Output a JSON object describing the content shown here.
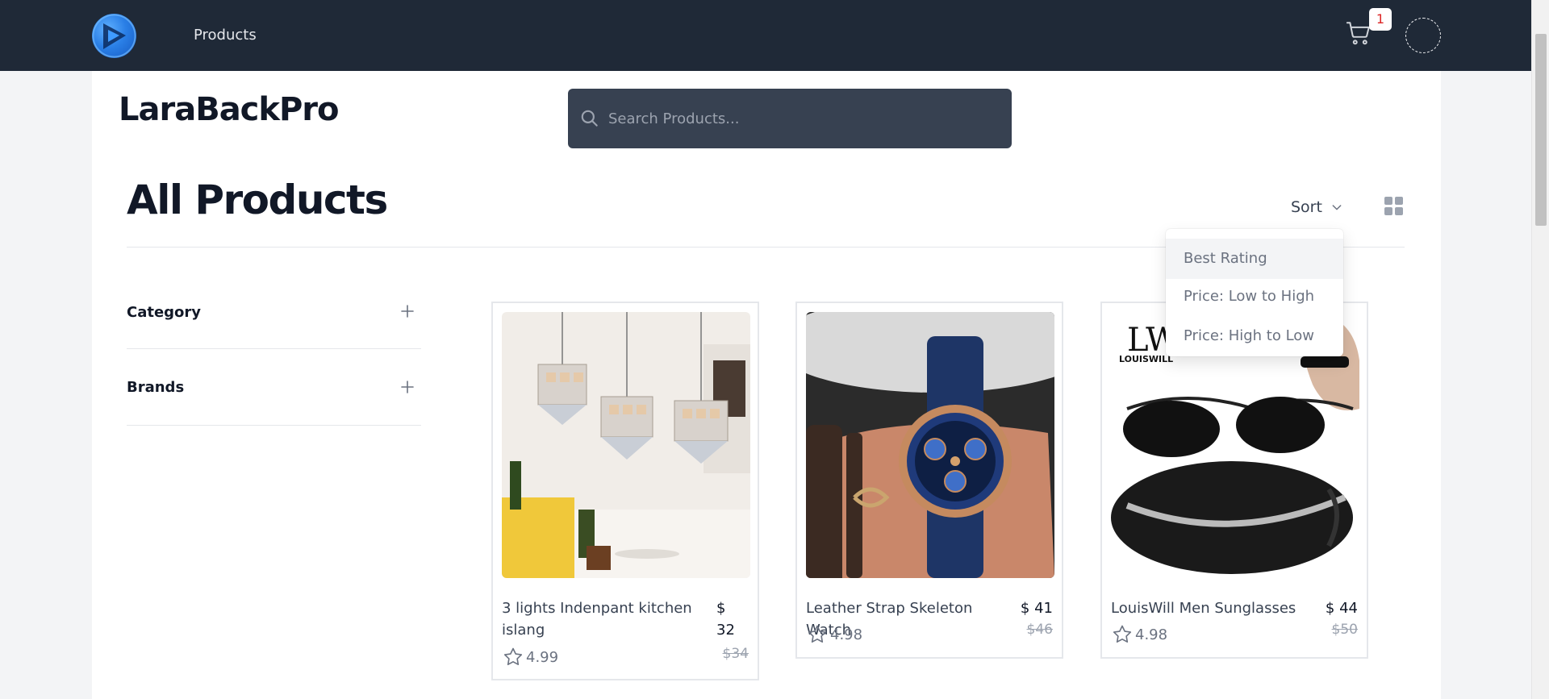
{
  "navbar": {
    "products_link": "Products",
    "cart_count": "1"
  },
  "brand": {
    "title": "LaraBackPro"
  },
  "search": {
    "placeholder": "Search Products..."
  },
  "page": {
    "title": "All Products"
  },
  "sort": {
    "label": "Sort",
    "options": [
      "Best Rating",
      "Price: Low to High",
      "Price: High to Low"
    ],
    "highlighted": "Best Rating"
  },
  "filters": [
    {
      "label": "Category"
    },
    {
      "label": "Brands"
    }
  ],
  "products": [
    {
      "name": "3 lights Indenpant kitchen islang",
      "price_symbol": "$",
      "price_value": "32",
      "old_price": "$34",
      "rating": "4.99"
    },
    {
      "name": "Leather Strap Skeleton Watch",
      "price": "$ 41",
      "old_price": "$46",
      "rating": "4.98"
    },
    {
      "name": "LouisWill Men Sunglasses",
      "price": "$ 44",
      "old_price": "$50",
      "rating": "4.98",
      "image_logo": "LW",
      "image_brand": "LOUISWILL"
    }
  ],
  "icons": {
    "cart": "shopping-cart-icon",
    "search": "search-icon",
    "sort": "chevron-down-icon",
    "grid": "grid-view-icon",
    "filter_toggle": "plus-icon",
    "rating": "star-icon"
  },
  "colors": {
    "navbar": "#1f2937",
    "search_bg": "#374151",
    "badge_text": "#dc2626"
  }
}
